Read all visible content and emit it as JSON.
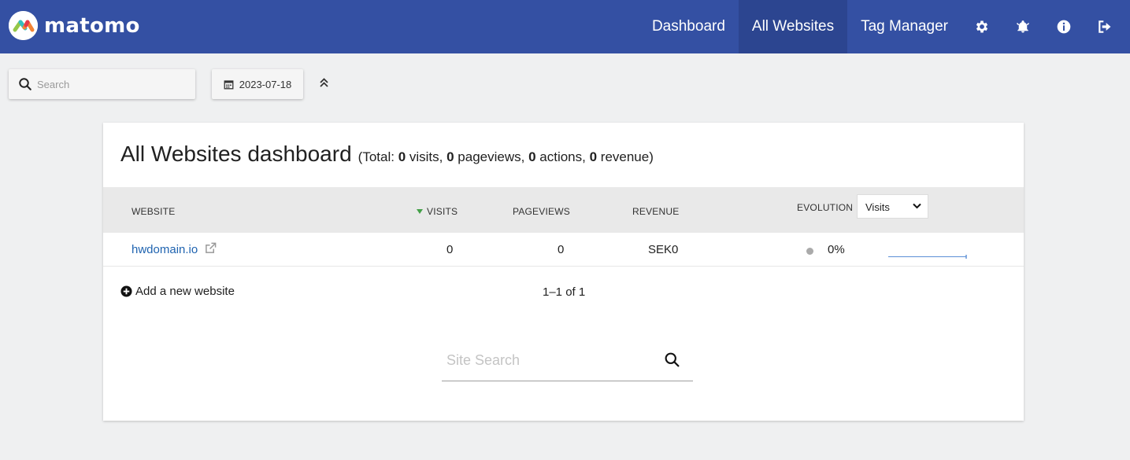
{
  "app": {
    "logo_text": "matomo"
  },
  "nav": {
    "items": [
      {
        "label": "Dashboard"
      },
      {
        "label": "All Websites"
      },
      {
        "label": "Tag Manager"
      }
    ],
    "icons": [
      "gear-icon",
      "bell-icon",
      "info-icon",
      "logout-icon"
    ]
  },
  "toolbar": {
    "search_placeholder": "Search",
    "date": "2023-07-18"
  },
  "dashboard": {
    "title": "All Websites dashboard",
    "total_prefix": "(Total: ",
    "total_visits": "0",
    "visits_label": " visits, ",
    "total_pageviews": "0",
    "pageviews_label": " pageviews, ",
    "total_actions": "0",
    "actions_label": " actions, ",
    "total_revenue": "0",
    "revenue_label": " revenue)"
  },
  "table": {
    "headers": {
      "website": "Website",
      "visits": "Visits",
      "pageviews": "Pageviews",
      "revenue": "Revenue",
      "evolution": "Evolution"
    },
    "evolution_metric": "Visits",
    "rows": [
      {
        "website": "hwdomain.io",
        "visits": "0",
        "pageviews": "0",
        "revenue": "SEK0",
        "evolution": "0%"
      }
    ]
  },
  "footer": {
    "add_website": "Add a new website",
    "pagination": "1–1 of 1"
  },
  "site_search": {
    "placeholder": "Site Search"
  },
  "colors": {
    "topbar": "#3450a3",
    "active_nav": "#2c4590",
    "link": "#1f63b0",
    "sort_arrow": "#43a047"
  }
}
